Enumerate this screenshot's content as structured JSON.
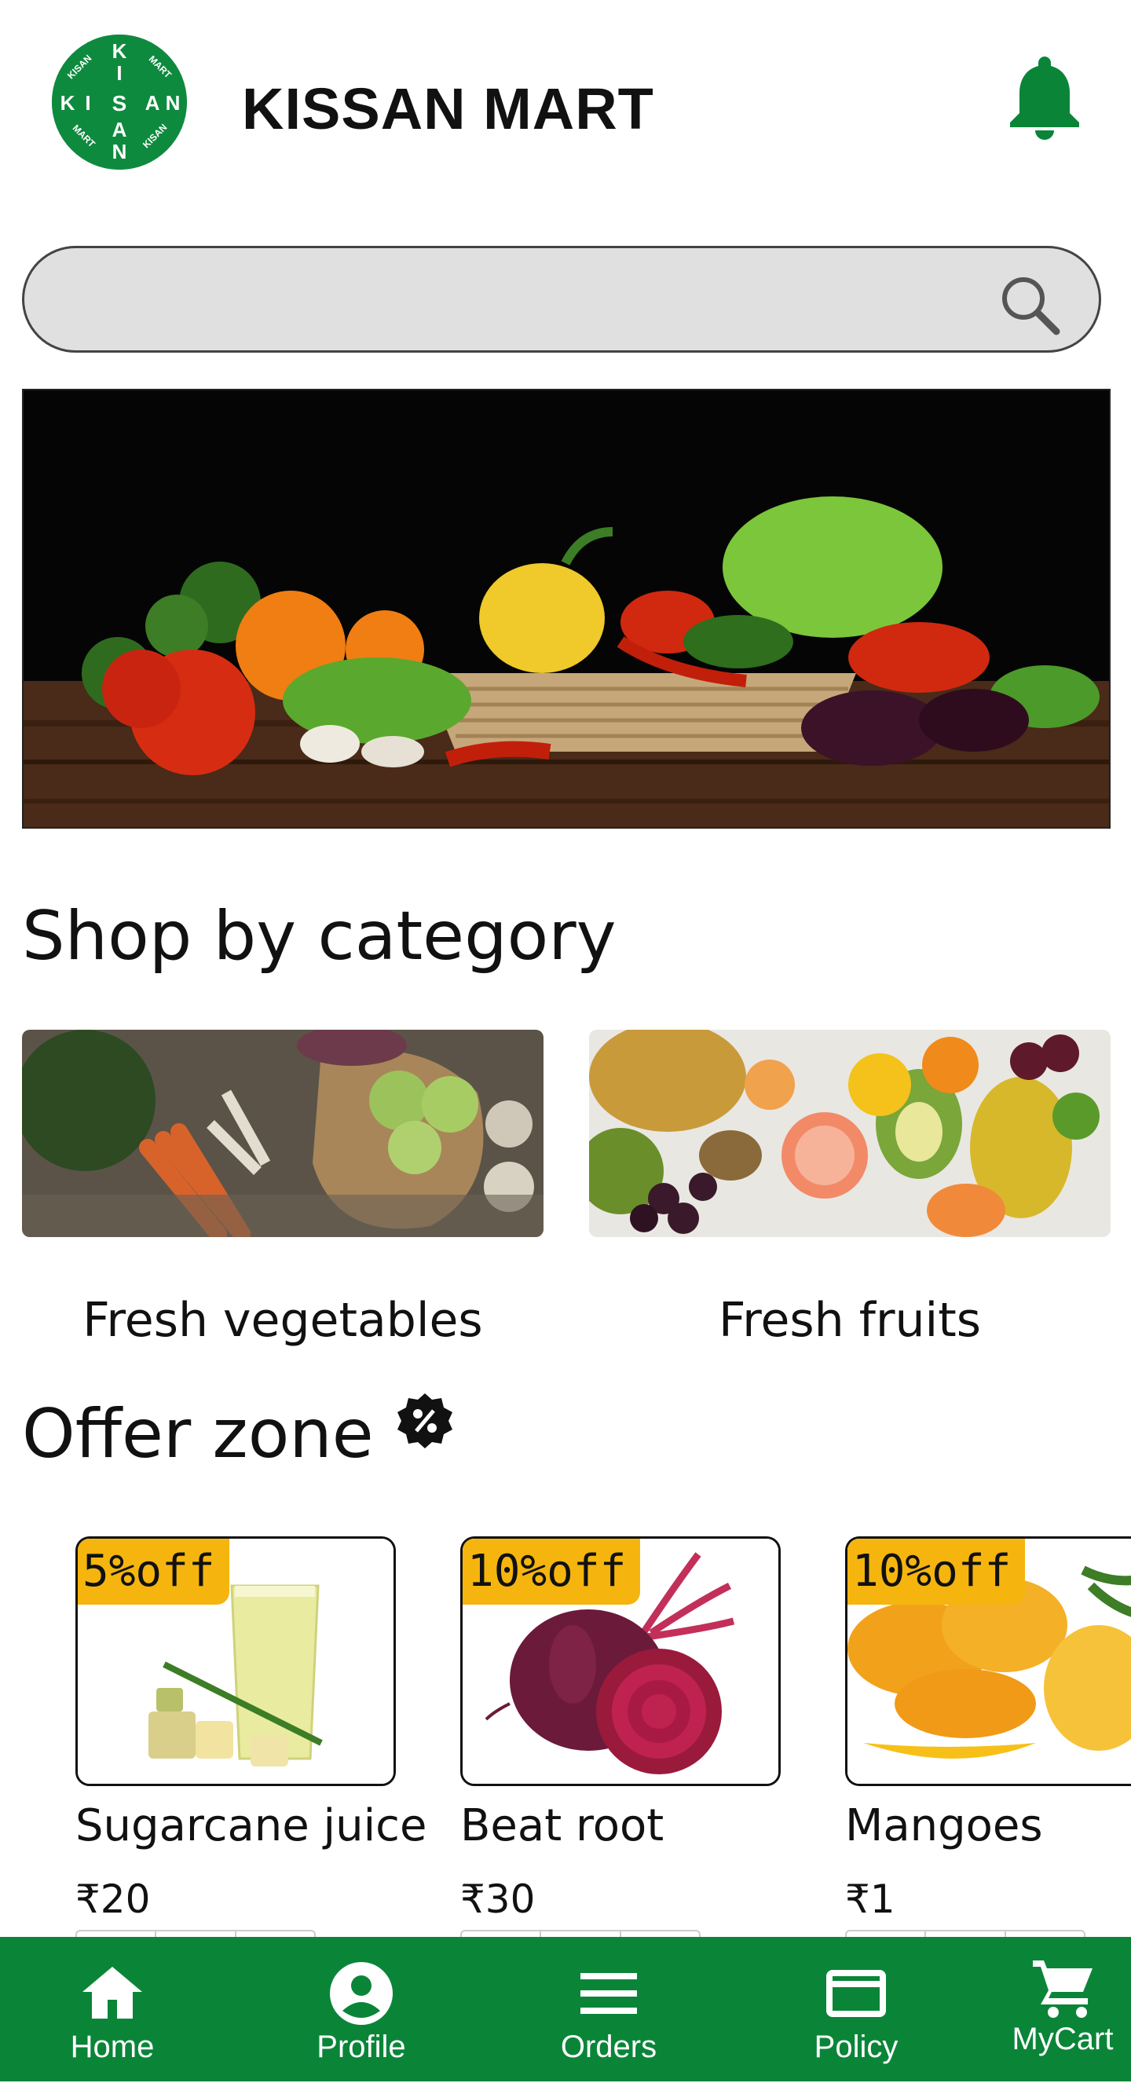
{
  "header": {
    "app_title": "KISSAN MART",
    "logo_text": "KISSAN MART",
    "notification_icon": "bell-icon"
  },
  "colors": {
    "brand_green": "#0a8538",
    "discount_badge": "#f5b50e",
    "search_bg": "#e0e0e0"
  },
  "search": {
    "placeholder": "",
    "value": "",
    "icon": "search-icon"
  },
  "banner": {
    "description_icon": "vegetables-banner-image"
  },
  "categories": {
    "title": "Shop by category",
    "items": [
      {
        "label": "Fresh vegetables",
        "image": "vegetables-image"
      },
      {
        "label": "Fresh fruits",
        "image": "fruits-image"
      }
    ]
  },
  "offers": {
    "title": "Offer zone",
    "badge_icon": "discount-badge-icon",
    "items": [
      {
        "discount": "5%off",
        "name": "Sugarcane juice",
        "price": "₹20",
        "image": "sugarcane-juice-image"
      },
      {
        "discount": "10%off",
        "name": "Beat root",
        "price": "₹30",
        "image": "beetroot-image"
      },
      {
        "discount": "10%off",
        "name": "Mangoes",
        "price": "₹1",
        "image": "mangoes-image"
      }
    ]
  },
  "nav": {
    "items": [
      {
        "label": "Home",
        "icon": "home-icon"
      },
      {
        "label": "Profile",
        "icon": "profile-icon"
      },
      {
        "label": "Orders",
        "icon": "menu-icon"
      },
      {
        "label": "Policy",
        "icon": "card-icon"
      },
      {
        "label": "MyCart",
        "icon": "cart-icon"
      }
    ]
  }
}
